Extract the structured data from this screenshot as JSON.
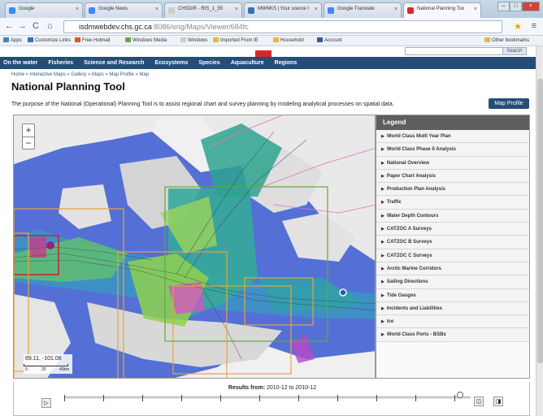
{
  "browser": {
    "tabs": [
      {
        "label": "Google",
        "color": "#4285f4"
      },
      {
        "label": "Google News",
        "color": "#4285f4"
      },
      {
        "label": "CHSDIR - RIS_1_55",
        "color": "#cccccc"
      },
      {
        "label": "MWNKS | Your source I",
        "color": "#3b6fb5"
      },
      {
        "label": "Google Translate",
        "color": "#4285f4"
      },
      {
        "label": "National Planning Too",
        "color": "#d62a2a"
      }
    ],
    "url_host": "isdmwebdev.chs.gc.ca",
    "url_path": ":8086/eng/Maps/Viewer/684fc",
    "bookmarks": [
      "Apps",
      "Customize Links",
      "Free Hotmail",
      "Windows Media",
      "Windows",
      "Imported From IE",
      "Household",
      "Account",
      "Other bookmarks"
    ]
  },
  "site": {
    "search_label": "Search",
    "nav": [
      "On the water",
      "Fisheries",
      "Science and Research",
      "Ecosystems",
      "Species",
      "Aquaculture",
      "Regions"
    ],
    "breadcrumb": "Home » Interactive Maps » Gallery » Maps » Map Profile » Map",
    "title": "National Planning Tool",
    "description": "The purpose of the National (Operational) Planning Tool is to assist regional chart and survey planning by modeling analytical processes on spatial data.",
    "map_profile_button": "Map Profile"
  },
  "map": {
    "zoom_in": "+",
    "zoom_out": "−",
    "coordinates": "69.11, -101.08",
    "scale_labels": [
      "0",
      "20",
      "40km"
    ]
  },
  "legend": {
    "title": "Legend",
    "items": [
      "World Class Multi Year Plan",
      "World Class Phase II Analysis",
      "National Overview",
      "Paper Chart Analysis",
      "Production Plan Analysis",
      "Traffic",
      "Water Depth Contours",
      "CATZOC A Surveys",
      "CATZOC B Surveys",
      "CATZOC C Surveys",
      "Arctic Marine Corridors",
      "Sailing Directions",
      "Tide Gauges",
      "Incidents and Liabilities",
      "Ice",
      "World Class Ports - BSBs"
    ]
  },
  "timeline": {
    "results_label": "Results from:",
    "results_range": "2010-12 to 2010-12"
  }
}
